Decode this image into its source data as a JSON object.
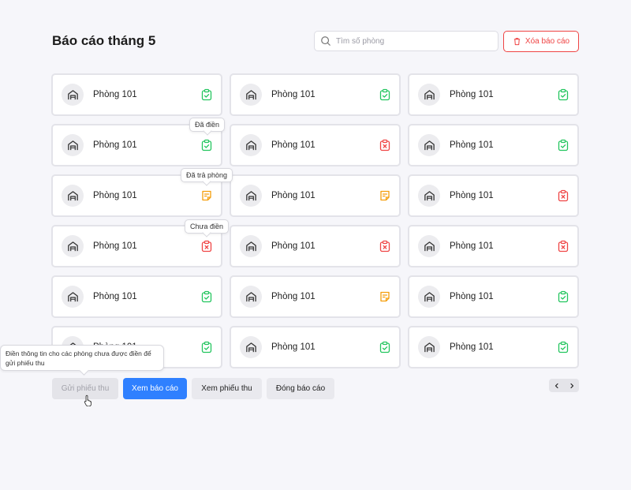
{
  "page": {
    "title": "Báo cáo tháng 5",
    "search_placeholder": "Tìm số phòng",
    "delete_label": "Xóa báo cáo"
  },
  "colors": {
    "accent": "#2f80ff",
    "danger": "#ef4444",
    "filled": "#22c55e",
    "returned": "#f59e0b",
    "not_filled": "#ef4444"
  },
  "rooms": [
    {
      "name": "Phòng 101",
      "status": "filled"
    },
    {
      "name": "Phòng 101",
      "status": "filled"
    },
    {
      "name": "Phòng 101",
      "status": "filled"
    },
    {
      "name": "Phòng 101",
      "status": "filled"
    },
    {
      "name": "Phòng 101",
      "status": "not_filled"
    },
    {
      "name": "Phòng 101",
      "status": "filled"
    },
    {
      "name": "Phòng 101",
      "status": "returned"
    },
    {
      "name": "Phòng 101",
      "status": "returned"
    },
    {
      "name": "Phòng 101",
      "status": "not_filled"
    },
    {
      "name": "Phòng 101",
      "status": "not_filled"
    },
    {
      "name": "Phòng 101",
      "status": "not_filled"
    },
    {
      "name": "Phòng 101",
      "status": "not_filled"
    },
    {
      "name": "Phòng 101",
      "status": "filled"
    },
    {
      "name": "Phòng 101",
      "status": "returned"
    },
    {
      "name": "Phòng 101",
      "status": "filled"
    },
    {
      "name": "Phòng 101",
      "status": "filled"
    },
    {
      "name": "Phòng 101",
      "status": "filled"
    },
    {
      "name": "Phòng 101",
      "status": "filled"
    }
  ],
  "tooltips": {
    "filled": "Đã điền",
    "returned": "Đã trả phòng",
    "not_filled": "Chưa điền",
    "send_hint": "Điền thông tin cho các phòng chưa được điền để gửi phiếu thu"
  },
  "actions": {
    "send_receipt": "Gửi phiếu thu",
    "view_report": "Xem báo cáo",
    "view_receipt": "Xem phiếu thu",
    "close_report": "Đóng báo cáo"
  },
  "pager": {
    "prev_icon": "chevron-left-icon",
    "next_icon": "chevron-right-icon"
  }
}
